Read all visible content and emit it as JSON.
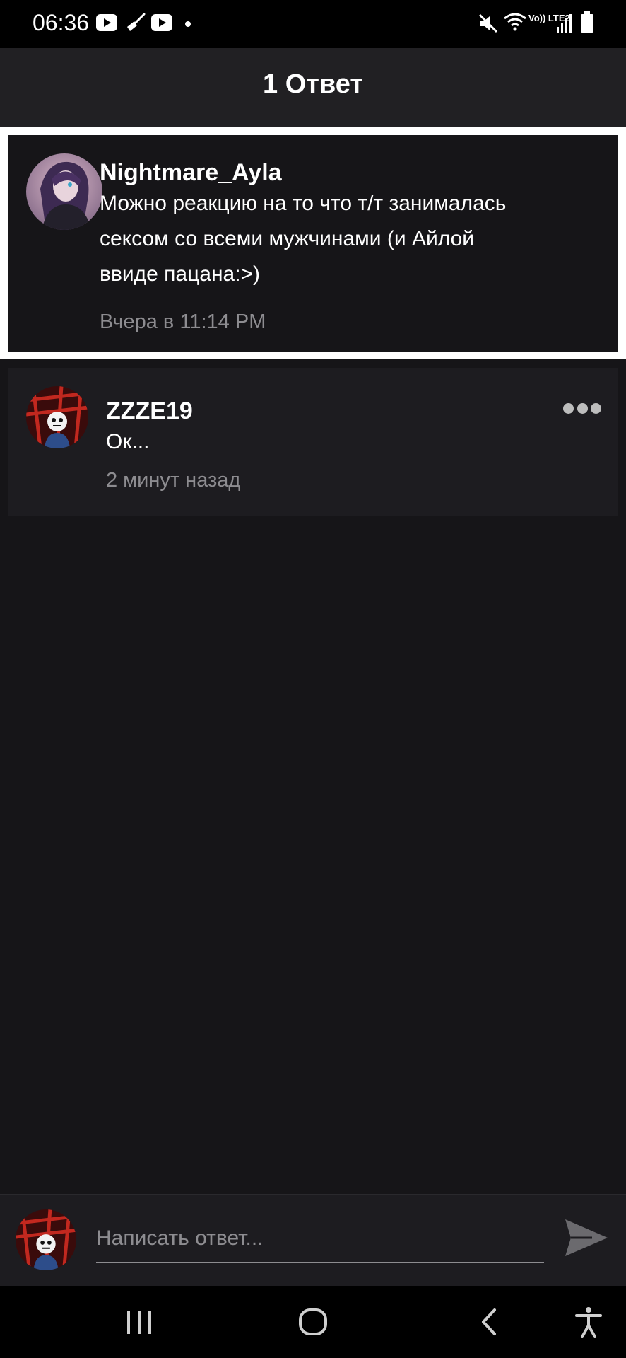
{
  "status_bar": {
    "time": "06:36",
    "network_label": "Vo)) LTE2",
    "icons": [
      "youtube-icon",
      "broom-icon",
      "youtube-icon",
      "dot-icon",
      "mute-icon",
      "wifi-icon",
      "signal-icon",
      "battery-icon"
    ]
  },
  "header": {
    "title": "1 Ответ"
  },
  "parent_comment": {
    "author": "Nightmare_Ayla",
    "text_lines": [
      "Можно реакцию на то что т/т занималась",
      "сексом со всеми мужчинами (и Айлой",
      "ввиде пацана:>)"
    ],
    "time": "Вчера в 11:14 PM"
  },
  "reply": {
    "author": "ZZZE19",
    "text": "Ок...",
    "time": "2 минут назад",
    "more_icon": "more-horizontal-icon"
  },
  "composer": {
    "placeholder": "Написать ответ...",
    "send_icon": "send-icon"
  },
  "nav": {
    "icons": [
      "recent-apps-icon",
      "home-icon",
      "back-icon",
      "accessibility-icon"
    ]
  },
  "colors": {
    "background": "#161518",
    "header": "#212023",
    "card": "#1d1c20",
    "secondary_text": "#8d8c90",
    "highlight_border": "#ffffff"
  }
}
